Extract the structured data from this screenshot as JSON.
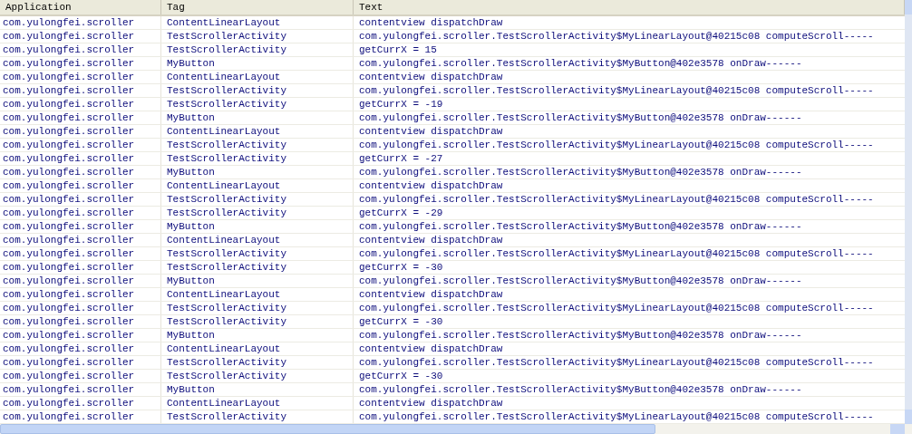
{
  "table": {
    "columns": [
      "Application",
      "Tag",
      "Text"
    ],
    "rows": [
      {
        "application": "com.yulongfei.scroller",
        "tag": "ContentLinearLayout",
        "text": "contentview dispatchDraw"
      },
      {
        "application": "com.yulongfei.scroller",
        "tag": "TestScrollerActivity",
        "text": "com.yulongfei.scroller.TestScrollerActivity$MyLinearLayout@40215c08 computeScroll-----"
      },
      {
        "application": "com.yulongfei.scroller",
        "tag": "TestScrollerActivity",
        "text": "getCurrX = 15"
      },
      {
        "application": "com.yulongfei.scroller",
        "tag": "MyButton",
        "text": "com.yulongfei.scroller.TestScrollerActivity$MyButton@402e3578 onDraw------"
      },
      {
        "application": "com.yulongfei.scroller",
        "tag": "ContentLinearLayout",
        "text": "contentview dispatchDraw"
      },
      {
        "application": "com.yulongfei.scroller",
        "tag": "TestScrollerActivity",
        "text": "com.yulongfei.scroller.TestScrollerActivity$MyLinearLayout@40215c08 computeScroll-----"
      },
      {
        "application": "com.yulongfei.scroller",
        "tag": "TestScrollerActivity",
        "text": "getCurrX = -19"
      },
      {
        "application": "com.yulongfei.scroller",
        "tag": "MyButton",
        "text": "com.yulongfei.scroller.TestScrollerActivity$MyButton@402e3578 onDraw------"
      },
      {
        "application": "com.yulongfei.scroller",
        "tag": "ContentLinearLayout",
        "text": "contentview dispatchDraw"
      },
      {
        "application": "com.yulongfei.scroller",
        "tag": "TestScrollerActivity",
        "text": "com.yulongfei.scroller.TestScrollerActivity$MyLinearLayout@40215c08 computeScroll-----"
      },
      {
        "application": "com.yulongfei.scroller",
        "tag": "TestScrollerActivity",
        "text": "getCurrX = -27"
      },
      {
        "application": "com.yulongfei.scroller",
        "tag": "MyButton",
        "text": "com.yulongfei.scroller.TestScrollerActivity$MyButton@402e3578 onDraw------"
      },
      {
        "application": "com.yulongfei.scroller",
        "tag": "ContentLinearLayout",
        "text": "contentview dispatchDraw"
      },
      {
        "application": "com.yulongfei.scroller",
        "tag": "TestScrollerActivity",
        "text": "com.yulongfei.scroller.TestScrollerActivity$MyLinearLayout@40215c08 computeScroll-----"
      },
      {
        "application": "com.yulongfei.scroller",
        "tag": "TestScrollerActivity",
        "text": "getCurrX = -29"
      },
      {
        "application": "com.yulongfei.scroller",
        "tag": "MyButton",
        "text": "com.yulongfei.scroller.TestScrollerActivity$MyButton@402e3578 onDraw------"
      },
      {
        "application": "com.yulongfei.scroller",
        "tag": "ContentLinearLayout",
        "text": "contentview dispatchDraw"
      },
      {
        "application": "com.yulongfei.scroller",
        "tag": "TestScrollerActivity",
        "text": "com.yulongfei.scroller.TestScrollerActivity$MyLinearLayout@40215c08 computeScroll-----"
      },
      {
        "application": "com.yulongfei.scroller",
        "tag": "TestScrollerActivity",
        "text": "getCurrX = -30"
      },
      {
        "application": "com.yulongfei.scroller",
        "tag": "MyButton",
        "text": "com.yulongfei.scroller.TestScrollerActivity$MyButton@402e3578 onDraw------"
      },
      {
        "application": "com.yulongfei.scroller",
        "tag": "ContentLinearLayout",
        "text": "contentview dispatchDraw"
      },
      {
        "application": "com.yulongfei.scroller",
        "tag": "TestScrollerActivity",
        "text": "com.yulongfei.scroller.TestScrollerActivity$MyLinearLayout@40215c08 computeScroll-----"
      },
      {
        "application": "com.yulongfei.scroller",
        "tag": "TestScrollerActivity",
        "text": "getCurrX = -30"
      },
      {
        "application": "com.yulongfei.scroller",
        "tag": "MyButton",
        "text": "com.yulongfei.scroller.TestScrollerActivity$MyButton@402e3578 onDraw------"
      },
      {
        "application": "com.yulongfei.scroller",
        "tag": "ContentLinearLayout",
        "text": "contentview dispatchDraw"
      },
      {
        "application": "com.yulongfei.scroller",
        "tag": "TestScrollerActivity",
        "text": "com.yulongfei.scroller.TestScrollerActivity$MyLinearLayout@40215c08 computeScroll-----"
      },
      {
        "application": "com.yulongfei.scroller",
        "tag": "TestScrollerActivity",
        "text": "getCurrX = -30"
      },
      {
        "application": "com.yulongfei.scroller",
        "tag": "MyButton",
        "text": "com.yulongfei.scroller.TestScrollerActivity$MyButton@402e3578 onDraw------"
      },
      {
        "application": "com.yulongfei.scroller",
        "tag": "ContentLinearLayout",
        "text": "contentview dispatchDraw"
      },
      {
        "application": "com.yulongfei.scroller",
        "tag": "TestScrollerActivity",
        "text": "com.yulongfei.scroller.TestScrollerActivity$MyLinearLayout@40215c08 computeScroll-----"
      }
    ]
  }
}
